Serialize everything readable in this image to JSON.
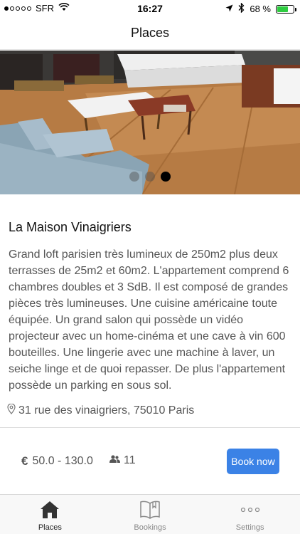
{
  "status_bar": {
    "carrier": "SFR",
    "time": "16:27",
    "battery_percent_text": "68 %",
    "battery_level": 0.68,
    "signal_bars_filled": 1,
    "signal_bars_total": 5,
    "battery_color": "#2ecc40"
  },
  "nav": {
    "title": "Places"
  },
  "hero": {
    "pager": {
      "count": 3,
      "active_index": 2
    }
  },
  "place": {
    "title": "La Maison Vinaigriers",
    "description": "Grand loft parisien très lumineux de 250m2 plus deux terrasses de 25m2 et 60m2. L'appartement comprend 6 chambres doubles et 3 SdB. Il est composé de grandes pièces très lumineuses. Une cuisine américaine toute équipée. Un grand salon qui possède un vidéo projecteur avec un home-cinéma et une cave à vin 600 bouteilles. Une lingerie avec une machine à laver, un seiche linge et de quoi repasser. De plus l'appartement possède un parking en sous sol.",
    "address": "31 rue des vinaigriers, 75010 Paris",
    "address_icon": "map-pin-icon"
  },
  "booking": {
    "currency_symbol": "€",
    "price_range": "50.0 - 130.0",
    "guests": "11",
    "guests_icon": "users-icon",
    "book_label": "Book now",
    "accent_color": "#3b82e6"
  },
  "tabs": [
    {
      "label": "Places",
      "icon": "home-icon",
      "active": true
    },
    {
      "label": "Bookings",
      "icon": "book-icon",
      "active": false
    },
    {
      "label": "Settings",
      "icon": "more-icon",
      "active": false
    }
  ]
}
